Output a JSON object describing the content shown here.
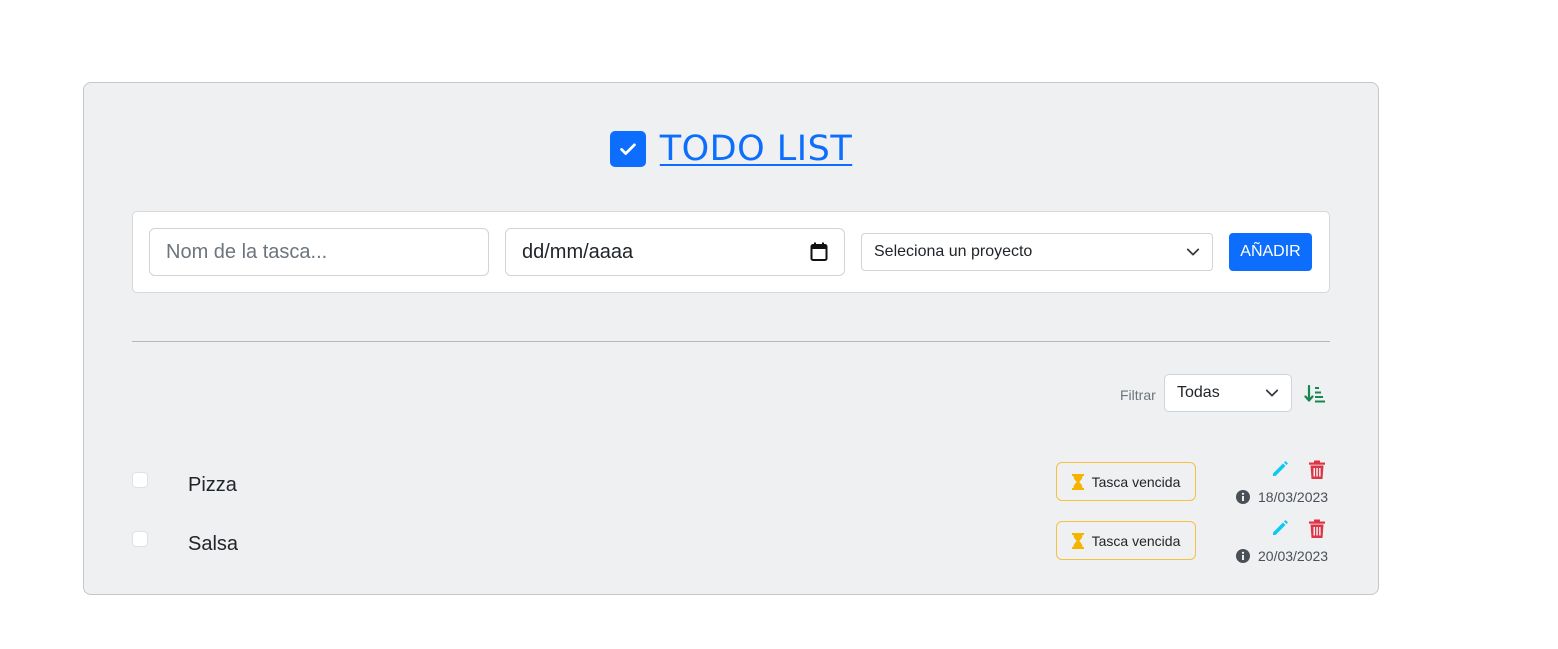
{
  "header": {
    "title": "TODO LIST",
    "icon": "checkbox-checked-icon"
  },
  "form": {
    "task_placeholder": "Nom de la tasca...",
    "date_value": "dd/mm/aaaa",
    "project_selected": "Seleciona un proyecto",
    "add_label": "AÑADIR"
  },
  "filter": {
    "label": "Filtrar",
    "selected": "Todas"
  },
  "tasks": [
    {
      "name": "Pizza",
      "status": "Tasca vencida",
      "date": "18/03/2023",
      "checked": false
    },
    {
      "name": "Salsa",
      "status": "Tasca vencida",
      "date": "20/03/2023",
      "checked": false
    }
  ],
  "colors": {
    "primary": "#0d6efd",
    "warning": "#ffc107",
    "info": "#0dcaf0",
    "danger": "#dc3545",
    "success": "#198754"
  }
}
